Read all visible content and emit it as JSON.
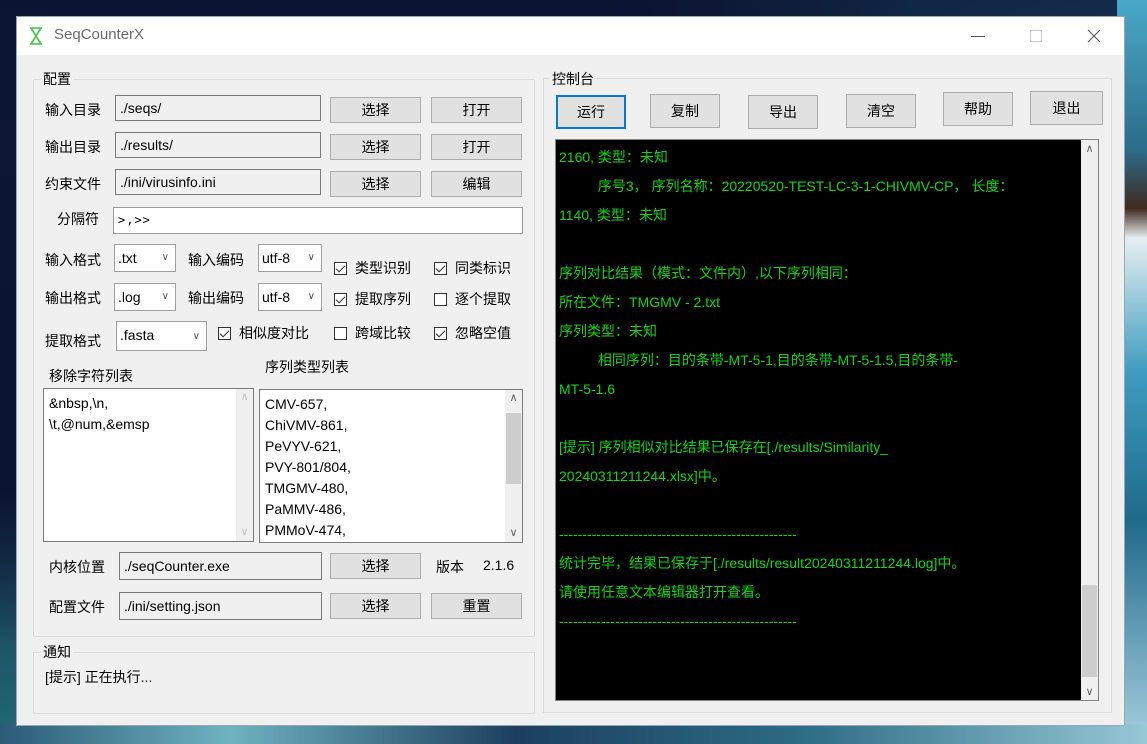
{
  "window": {
    "title": "SeqCounterX",
    "app_icon": "hourglass-icon",
    "controls": [
      "minimize",
      "maximize",
      "close"
    ]
  },
  "config": {
    "group_label": "配置",
    "input_dir": {
      "label": "输入目录",
      "value": "./seqs/",
      "select_label": "选择",
      "open_label": "打开"
    },
    "output_dir": {
      "label": "输出目录",
      "value": "./results/",
      "select_label": "选择",
      "open_label": "打开"
    },
    "constraint_file": {
      "label": "约束文件",
      "value": "./ini/virusinfo.ini",
      "select_label": "选择",
      "edit_label": "编辑"
    },
    "separator": {
      "label": "分隔符",
      "value": ">,>>"
    },
    "input_format": {
      "label": "输入格式",
      "value": ".txt"
    },
    "input_encoding": {
      "label": "输入编码",
      "value": "utf-8"
    },
    "output_format": {
      "label": "输出格式",
      "value": ".log"
    },
    "output_encoding": {
      "label": "输出编码",
      "value": "utf-8"
    },
    "extract_format": {
      "label": "提取格式",
      "value": ".fasta"
    },
    "checkboxes": [
      {
        "label": "类型识别",
        "checked": true
      },
      {
        "label": "同类标识",
        "checked": true
      },
      {
        "label": "提取序列",
        "checked": true
      },
      {
        "label": "逐个提取",
        "checked": false
      },
      {
        "label": "相似度对比",
        "checked": true
      },
      {
        "label": "跨域比较",
        "checked": false
      },
      {
        "label": "忽略空值",
        "checked": true
      }
    ],
    "remove_chars": {
      "label": "移除字符列表",
      "lines": [
        "&nbsp,\\n,",
        "\\t,@num,&emsp"
      ]
    },
    "seq_types": {
      "label": "序列类型列表",
      "lines": [
        "CMV-657,",
        "ChiVMV-861,",
        "PeVYV-621,",
        "PVY-801/804,",
        "TMGMV-480,",
        "PaMMV-486,",
        "PMMoV-474,"
      ]
    },
    "kernel": {
      "label": "内核位置",
      "value": "./seqCounter.exe",
      "select_label": "选择"
    },
    "version": {
      "label": "版本",
      "value": "2.1.6"
    },
    "config_file": {
      "label": "配置文件",
      "value": "./ini/setting.json",
      "select_label": "选择",
      "reset_label": "重置"
    }
  },
  "notice": {
    "group_label": "通知",
    "message": "[提示] 正在执行..."
  },
  "console": {
    "group_label": "控制台",
    "buttons": [
      "运行",
      "复制",
      "导出",
      "清空",
      "帮助",
      "退出"
    ],
    "text_color": "#17d217",
    "background": "#000000",
    "lines": [
      "2160, 类型：未知",
      "          序号3， 序列名称：20220520-TEST-LC-3-1-CHIVMV-CP， 长度：",
      "1140, 类型：未知",
      "",
      "序列对比结果（模式：文件内）,以下序列相同：",
      "所在文件：TMGMV - 2.txt",
      "序列类型：未知",
      "          相同序列：目的条带-MT-5-1,目的条带-MT-5-1.5,目的条带-",
      "MT-5-1.6",
      "",
      "[提示] 序列相似对比结果已保存在[./results/Similarity_",
      "20240311211244.xlsx]中。",
      "",
      "---------------------------------------------------",
      "统计完毕，结果已保存于[./results/result20240311211244.log]中。",
      "请使用任意文本编辑器打开查看。",
      "---------------------------------------------------"
    ]
  }
}
